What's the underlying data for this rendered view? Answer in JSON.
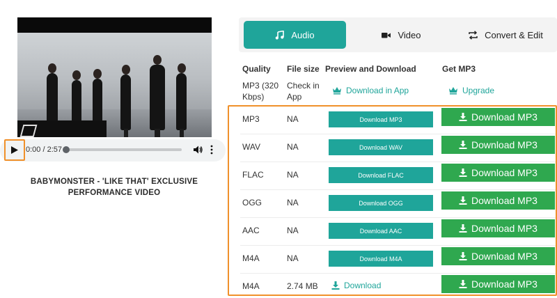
{
  "player": {
    "time": "0:00 / 2:57",
    "progress": 0,
    "title": "BABYMONSTER - 'LIKE THAT' EXCLUSIVE PERFORMANCE VIDEO"
  },
  "tabs": [
    {
      "label": "Audio",
      "icon": "music-note-icon",
      "active": true
    },
    {
      "label": "Video",
      "icon": "video-camera-icon",
      "active": false
    },
    {
      "label": "Convert & Edit",
      "icon": "convert-arrows-icon",
      "active": false
    }
  ],
  "table": {
    "headers": {
      "quality": "Quality",
      "file_size": "File size",
      "preview": "Preview and Download",
      "get_mp3": "Get MP3"
    },
    "app_row": {
      "quality": "MP3 (320 Kbps)",
      "size": "Check in App",
      "preview_link": "Download in App",
      "get_link": "Upgrade",
      "icon": "crown-icon"
    },
    "rows": [
      {
        "quality": "MP3",
        "size": "NA",
        "preview": "Download MP3",
        "get": "Download MP3"
      },
      {
        "quality": "WAV",
        "size": "NA",
        "preview": "Download WAV",
        "get": "Download MP3"
      },
      {
        "quality": "FLAC",
        "size": "NA",
        "preview": "Download FLAC",
        "get": "Download MP3"
      },
      {
        "quality": "OGG",
        "size": "NA",
        "preview": "Download OGG",
        "get": "Download MP3"
      },
      {
        "quality": "AAC",
        "size": "NA",
        "preview": "Download AAC",
        "get": "Download MP3"
      },
      {
        "quality": "M4A",
        "size": "NA",
        "preview": "Download M4A",
        "get": "Download MP3"
      },
      {
        "quality": "M4A",
        "size": "2.74 MB",
        "preview_link": "Download",
        "get": "Download MP3"
      }
    ]
  },
  "colors": {
    "accent_teal": "#1fa59a",
    "download_green": "#2fa84f",
    "highlight_orange": "#f0902a"
  }
}
